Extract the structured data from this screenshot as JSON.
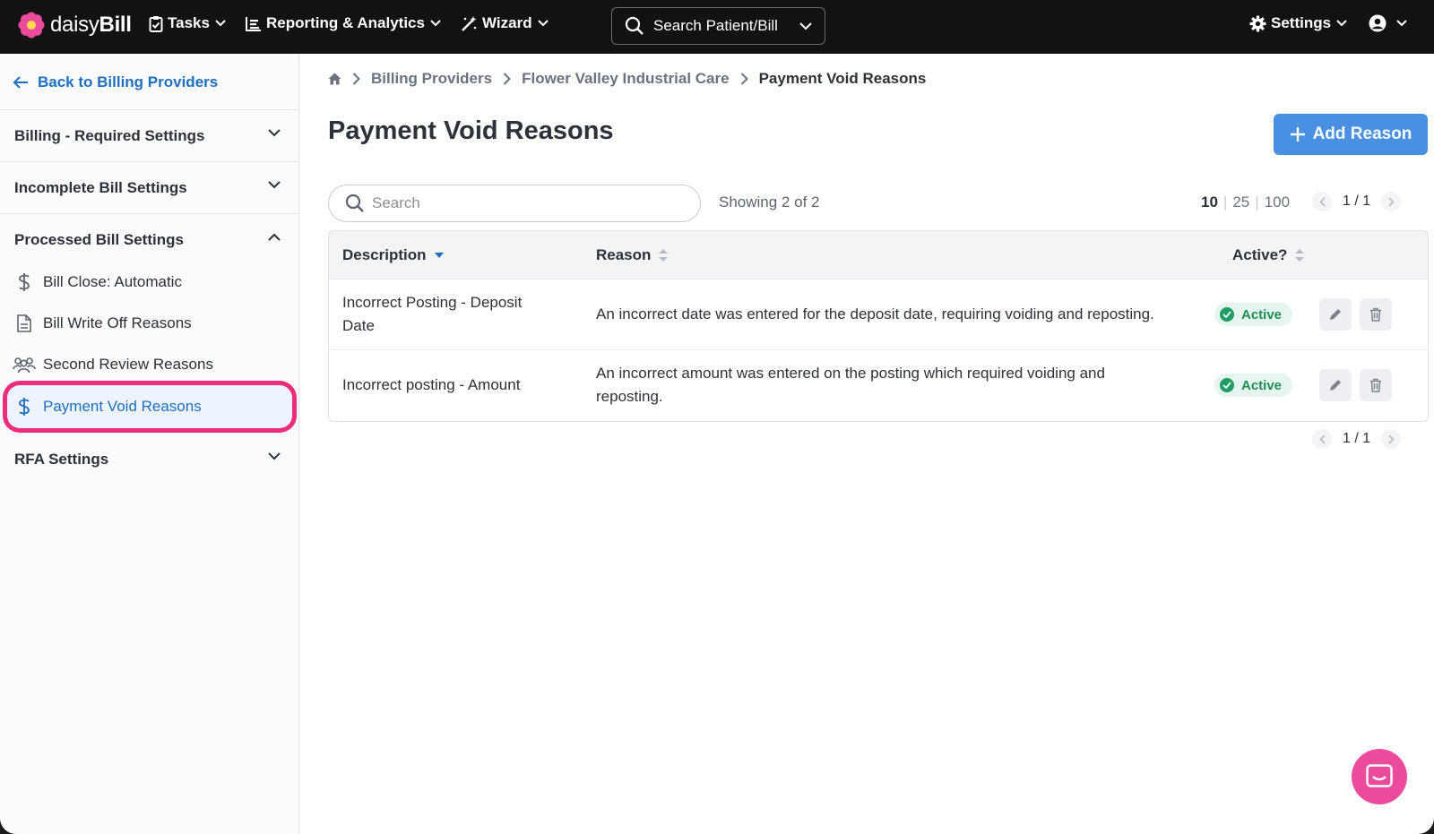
{
  "brand": {
    "name_light": "daisy",
    "name_bold": "Bill"
  },
  "nav": {
    "tasks": "Tasks",
    "reporting": "Reporting & Analytics",
    "wizard": "Wizard",
    "search_label": "Search Patient/Bill",
    "settings": "Settings"
  },
  "sidebar": {
    "back_label": "Back to Billing Providers",
    "sections": [
      {
        "label": "Billing - Required Settings",
        "expanded": false
      },
      {
        "label": "Incomplete Bill Settings",
        "expanded": false
      },
      {
        "label": "Processed Bill Settings",
        "expanded": true
      },
      {
        "label": "RFA Settings",
        "expanded": false
      }
    ],
    "items": [
      {
        "label": "Bill Close: Automatic",
        "icon": "dollar-icon"
      },
      {
        "label": "Bill Write Off Reasons",
        "icon": "document-icon"
      },
      {
        "label": "Second Review Reasons",
        "icon": "users-icon"
      },
      {
        "label": "Payment Void Reasons",
        "icon": "dollar-icon",
        "active": true
      }
    ]
  },
  "breadcrumb": {
    "items": [
      "Billing Providers",
      "Flower Valley Industrial Care"
    ],
    "current": "Payment Void Reasons"
  },
  "page": {
    "title": "Payment Void Reasons",
    "add_button": "Add Reason",
    "search_placeholder": "Search",
    "showing": "Showing 2 of 2",
    "page_sizes": [
      "10",
      "25",
      "100"
    ],
    "selected_page_size": "10",
    "pagination": "1 / 1"
  },
  "table": {
    "columns": [
      "Description",
      "Reason",
      "Active?"
    ],
    "rows": [
      {
        "description": "Incorrect Posting - Deposit Date",
        "reason": "An incorrect date was entered for the deposit date, requiring voiding and reposting.",
        "status": "Active"
      },
      {
        "description": "Incorrect posting - Amount",
        "reason": "An incorrect amount was entered on the posting which required voiding and reposting.",
        "status": "Active"
      }
    ]
  },
  "colors": {
    "accent": "#4a90e2",
    "link": "#1f6fbf",
    "highlight": "#ec2d79",
    "active_badge": "#1f9d63",
    "chat": "#ec4b9b"
  }
}
